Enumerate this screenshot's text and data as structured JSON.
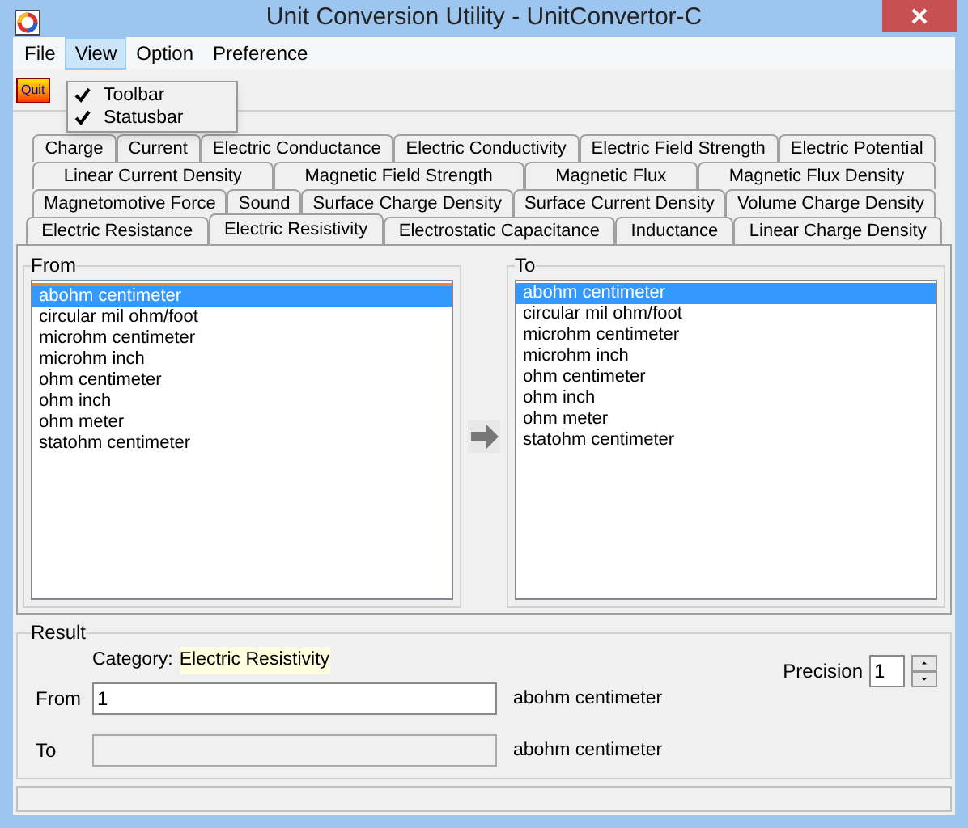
{
  "window": {
    "title": "Unit Conversion Utility - UnitConvertor-C"
  },
  "menu": [
    {
      "label": "File",
      "selected": false
    },
    {
      "label": "View",
      "selected": true
    },
    {
      "label": "Option",
      "selected": false
    },
    {
      "label": "Preference",
      "selected": false
    }
  ],
  "view_menu": [
    {
      "label": "Toolbar",
      "checked": true
    },
    {
      "label": "Statusbar",
      "checked": true
    }
  ],
  "toolbar": {
    "quit_button": "Quit"
  },
  "tab_rows": [
    [
      {
        "label": "Charge",
        "selected": false
      },
      {
        "label": "Current",
        "selected": false
      },
      {
        "label": "Electric Conductance",
        "selected": false
      },
      {
        "label": "Electric Conductivity",
        "selected": false
      },
      {
        "label": "Electric Field Strength",
        "selected": false
      },
      {
        "label": "Electric Potential",
        "selected": false
      }
    ],
    [
      {
        "label": "Linear Current Density",
        "selected": false
      },
      {
        "label": "Magnetic Field Strength",
        "selected": false
      },
      {
        "label": "Magnetic Flux",
        "selected": false
      },
      {
        "label": "Magnetic Flux Density",
        "selected": false
      }
    ],
    [
      {
        "label": "Magnetomotive Force",
        "selected": false
      },
      {
        "label": "Sound",
        "selected": false
      },
      {
        "label": "Surface Charge Density",
        "selected": false
      },
      {
        "label": "Surface Current Density",
        "selected": false
      },
      {
        "label": "Volume Charge Density",
        "selected": false
      }
    ],
    [
      {
        "label": "Electric Resistance",
        "selected": false
      },
      {
        "label": "Electric Resistivity",
        "selected": true
      },
      {
        "label": "Electrostatic Capacitance",
        "selected": false
      },
      {
        "label": "Inductance",
        "selected": false
      },
      {
        "label": "Linear Charge Density",
        "selected": false
      }
    ]
  ],
  "lists": [
    {
      "title": "From",
      "items": [
        {
          "label": "abohm centimeter",
          "selected": true
        },
        {
          "label": "circular mil ohm/foot",
          "selected": false
        },
        {
          "label": "microhm centimeter",
          "selected": false
        },
        {
          "label": "microhm inch",
          "selected": false
        },
        {
          "label": "ohm centimeter",
          "selected": false
        },
        {
          "label": "ohm inch",
          "selected": false
        },
        {
          "label": "ohm meter",
          "selected": false
        },
        {
          "label": "statohm centimeter",
          "selected": false
        }
      ]
    },
    {
      "title": "To",
      "items": [
        {
          "label": "abohm centimeter",
          "selected": true
        },
        {
          "label": "circular mil ohm/foot",
          "selected": false
        },
        {
          "label": "microhm centimeter",
          "selected": false
        },
        {
          "label": "microhm inch",
          "selected": false
        },
        {
          "label": "ohm centimeter",
          "selected": false
        },
        {
          "label": "ohm inch",
          "selected": false
        },
        {
          "label": "ohm meter",
          "selected": false
        },
        {
          "label": "statohm centimeter",
          "selected": false
        }
      ]
    }
  ],
  "result": {
    "title": "Result",
    "category_label": "Category:",
    "category": "Electric Resistivity",
    "precision_label": "Precision",
    "precision": "1",
    "from_label": "From",
    "from_value": "1",
    "from_unit": "abohm centimeter",
    "to_label": "To",
    "to_unit": "abohm centimeter"
  }
}
